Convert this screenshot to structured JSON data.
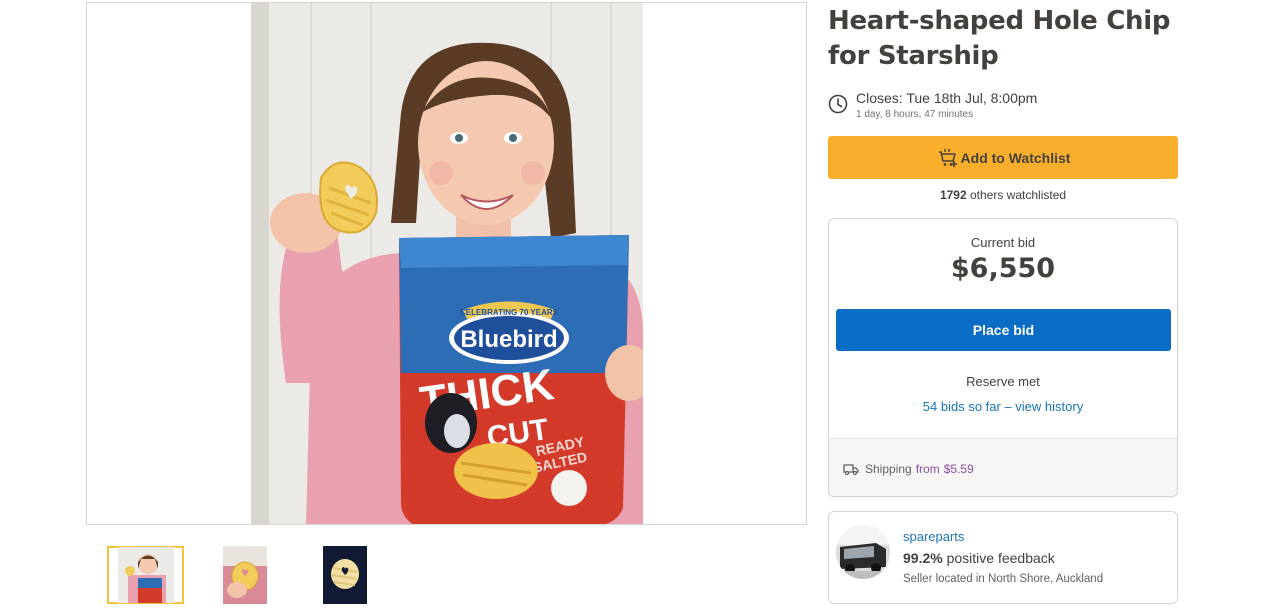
{
  "listing": {
    "title": "Heart-shaped Hole Chip for Starship",
    "closes_label": "Closes: Tue 18th Jul, 8:00pm",
    "closes_countdown": "1 day, 8 hours, 47 minutes"
  },
  "watchlist": {
    "button_label": "Add to Watchlist",
    "count": "1792",
    "count_suffix": "others watchlisted",
    "button_color": "#f9af2c"
  },
  "bidding": {
    "current_bid_label": "Current bid",
    "current_bid_value": "$6,550",
    "place_bid_label": "Place bid",
    "place_bid_color": "#0a6cc4",
    "reserve_status": "Reserve met",
    "bids_history_link": "54 bids so far – view history"
  },
  "shipping": {
    "label": "Shipping",
    "from_word": "from",
    "amount": "$5.59"
  },
  "seller": {
    "name": "spareparts",
    "feedback_percent": "99.2%",
    "feedback_suffix": "positive feedback",
    "location": "Seller located in North Shore, Auckland"
  },
  "product_image": {
    "bag_brand": "Bluebird",
    "bag_banner": "CELEBRATING 70 YEARS",
    "bag_line1": "THICK",
    "bag_line2": "CUT",
    "bag_flavour1": "READY",
    "bag_flavour2": "SALTED"
  },
  "gallery": {
    "thumbnails": [
      "thumbnail-girl-with-chip",
      "thumbnail-chip-closeup",
      "thumbnail-chip-dark-background"
    ],
    "selected_index": 0,
    "selected_border_color": "#f5c23c"
  },
  "icons": {
    "clock": "clock-icon",
    "watchlist": "watchlist-icon",
    "shipping": "truck-icon"
  }
}
